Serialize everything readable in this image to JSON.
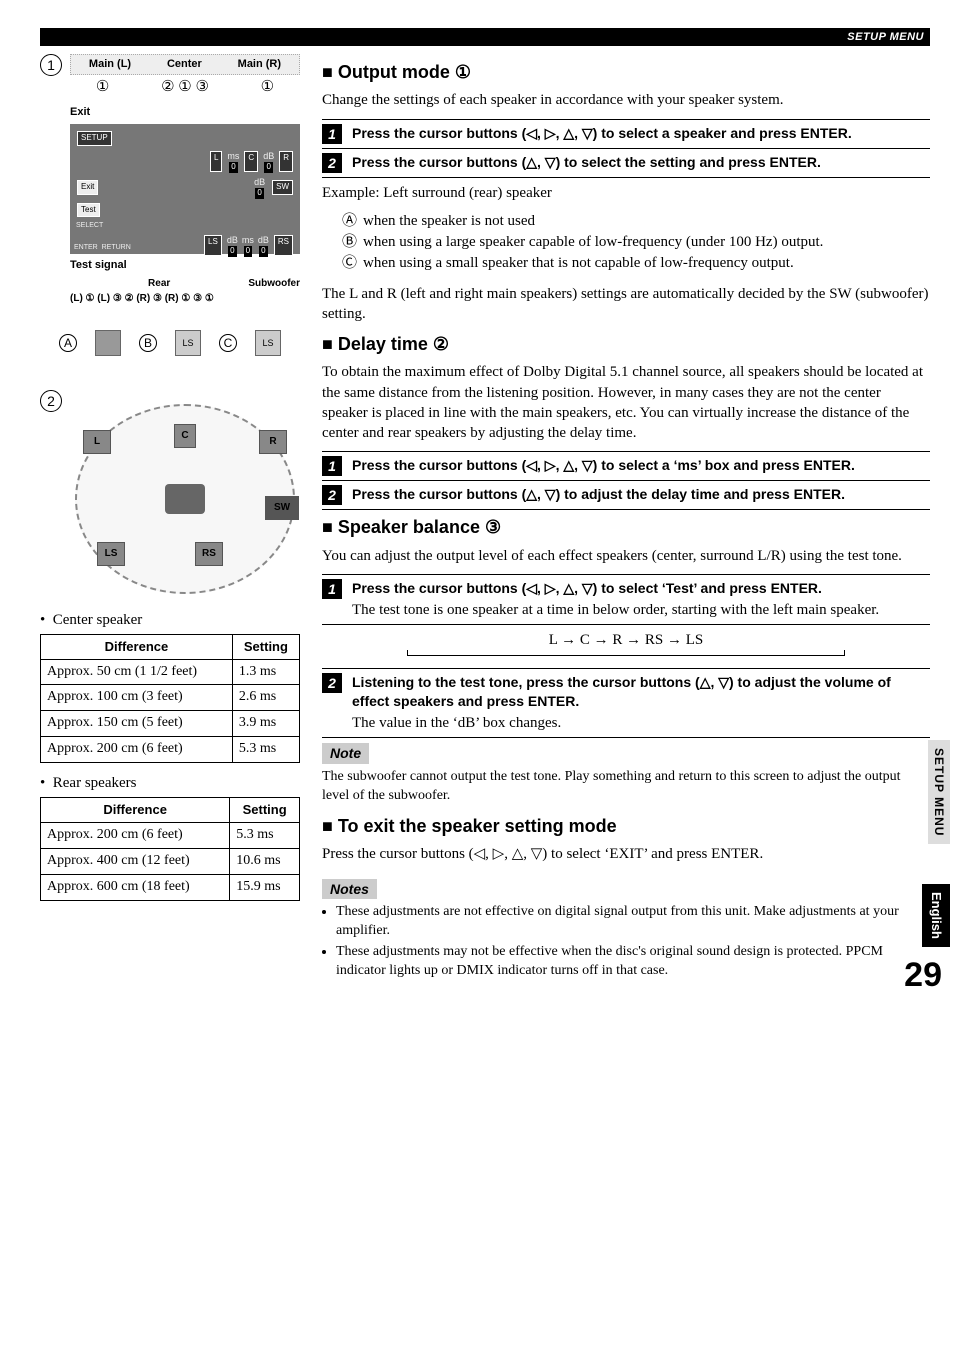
{
  "top_bar": "SETUP MENU",
  "side_tab": "SETUP MENU",
  "english_tab": "English",
  "page_number": "29",
  "fig1": {
    "number": "1",
    "top_labels": [
      "Main (L)",
      "Center",
      "Main (R)"
    ],
    "top_circles_row": [
      "①",
      "② ① ③",
      "①"
    ],
    "exit": "Exit",
    "setup_title": "SETUP",
    "screen_fields": {
      "L": "L",
      "ms": "ms",
      "C": "C",
      "dB": "dB",
      "R": "R",
      "Exit": "Exit",
      "SW": "SW",
      "Test": "Test",
      "LS": "LS",
      "RS": "RS",
      "zero": "0",
      "SELECT": "SELECT",
      "ENTER": "ENTER",
      "RETURN": "RETURN"
    },
    "test_signal": "Test signal",
    "bottom_block_labels": {
      "rear": "Rear",
      "sw": "Subwoofer"
    },
    "bottom_row": "(L) ①  (L) ③ ②   (R) ③ (R) ①      ③  ①",
    "abc": {
      "A": "A",
      "B": "B",
      "C": "C",
      "ls": "LS",
      "ls2": "LS"
    }
  },
  "fig2": {
    "number": "2",
    "spk": {
      "L": "L",
      "C": "C",
      "R": "R",
      "SW": "SW",
      "LS": "LS",
      "RS": "RS"
    }
  },
  "center_table": {
    "title": "Center speaker",
    "headers": [
      "Difference",
      "Setting"
    ],
    "rows": [
      [
        "Approx. 50 cm (1 1/2 feet)",
        "1.3 ms"
      ],
      [
        "Approx. 100 cm (3 feet)",
        "2.6 ms"
      ],
      [
        "Approx. 150 cm (5 feet)",
        "3.9 ms"
      ],
      [
        "Approx. 200 cm (6 feet)",
        "5.3 ms"
      ]
    ]
  },
  "rear_table": {
    "title": "Rear speakers",
    "headers": [
      "Difference",
      "Setting"
    ],
    "rows": [
      [
        "Approx. 200 cm (6 feet)",
        "5.3 ms"
      ],
      [
        "Approx. 400 cm (12 feet)",
        "10.6 ms"
      ],
      [
        "Approx. 600 cm (18 feet)",
        "15.9 ms"
      ]
    ]
  },
  "output_mode": {
    "heading": "Output mode ①",
    "intro": "Change the settings of each speaker in accordance with your speaker system.",
    "step1": "Press the cursor buttons (◁, ▷, △, ▽) to select a speaker and press ENTER.",
    "step2": "Press the cursor buttons (△, ▽) to select the setting and press ENTER.",
    "example_head": "Example: Left surround (rear) speaker",
    "examples": [
      {
        "k": "Ⓐ",
        "v": "when the speaker is not used"
      },
      {
        "k": "Ⓑ",
        "v": "when using a large speaker capable of low-frequency (under 100 Hz) output."
      },
      {
        "k": "Ⓒ",
        "v": "when using a small speaker that is not capable of low-frequency output."
      }
    ],
    "tail": "The L and R (left and right main speakers) settings are automatically decided by the SW (subwoofer) setting."
  },
  "delay_time": {
    "heading": "Delay time ②",
    "intro": "To obtain the maximum effect of Dolby Digital 5.1 channel source, all speakers should be located at the same distance from the listening position. However, in many cases they are not the center speaker is placed in line with the main speakers, etc. You can virtually increase the distance of the center and rear speakers by adjusting the delay time.",
    "step1": "Press the cursor buttons (◁, ▷, △, ▽) to select a ‘ms’ box and press ENTER.",
    "step2": "Press the cursor buttons (△, ▽) to adjust the delay time and press ENTER."
  },
  "speaker_balance": {
    "heading": "Speaker balance ③",
    "intro": "You can adjust the output level of each effect speakers (center, surround L/R) using the test tone.",
    "step1": "Press the cursor buttons (◁, ▷, △, ▽) to select ‘Test’ and press ENTER.",
    "step1_sub": "The test tone is one speaker at a time in below order, starting with the left main speaker.",
    "tone_order": "L → C → R → RS → LS",
    "step2": "Listening to the test tone, press the cursor buttons (△, ▽) to adjust the volume of effect speakers and press ENTER.",
    "step2_sub": "The value in the ‘dB’ box changes.",
    "note_label": "Note",
    "note": "The subwoofer cannot output the test tone. Play something and return to this screen to adjust the output level of the subwoofer."
  },
  "exit_mode": {
    "heading": "To exit the speaker setting mode",
    "body": "Press the cursor buttons (◁, ▷, △, ▽) to select ‘EXIT’ and press ENTER.",
    "notes_label": "Notes",
    "notes": [
      "These adjustments are not effective on digital signal output from this unit. Make adjustments at your amplifier.",
      "These adjustments may not be effective when the disc's original sound design is protected. PPCM indicator lights up or DMIX indicator turns off in that case."
    ]
  }
}
